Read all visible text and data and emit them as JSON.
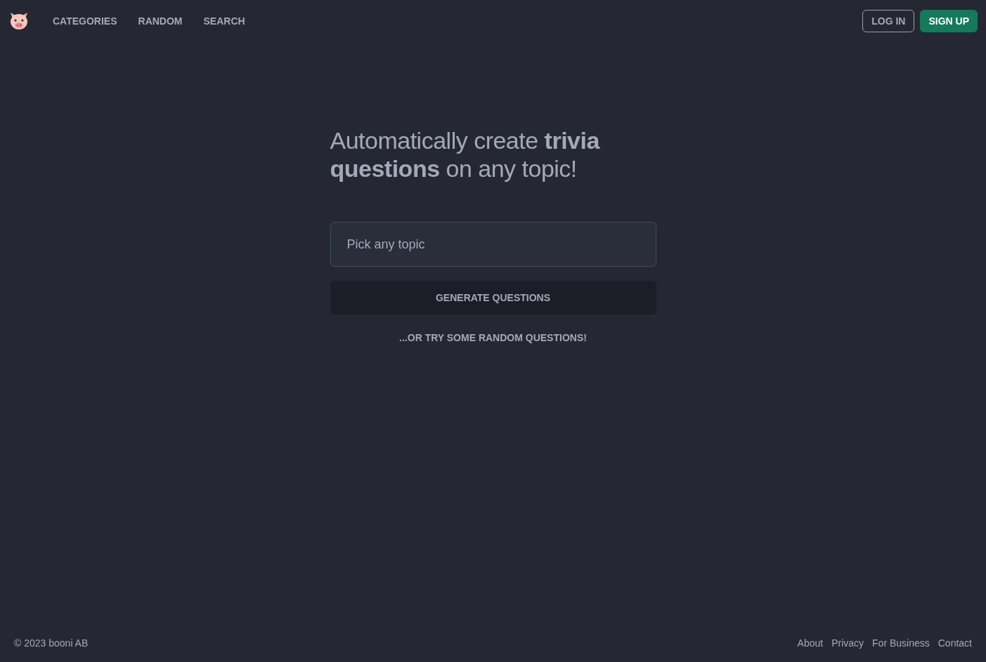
{
  "nav": {
    "links": [
      "CATEGORIES",
      "RANDOM",
      "SEARCH"
    ],
    "login": "LOG IN",
    "signup": "SIGN UP"
  },
  "hero": {
    "headline": "Automatically create **trivia questions** on any topic!",
    "topic_field": {
      "placeholder": "Pick any topic"
    },
    "generate_button": "GENERATE QUESTIONS",
    "random_link": "...OR TRY SOME RANDOM QUESTIONS!"
  },
  "footer": {
    "copyright": "© 2023 booni AB",
    "links": [
      "About",
      "Privacy",
      "For Business",
      "Contact"
    ]
  }
}
